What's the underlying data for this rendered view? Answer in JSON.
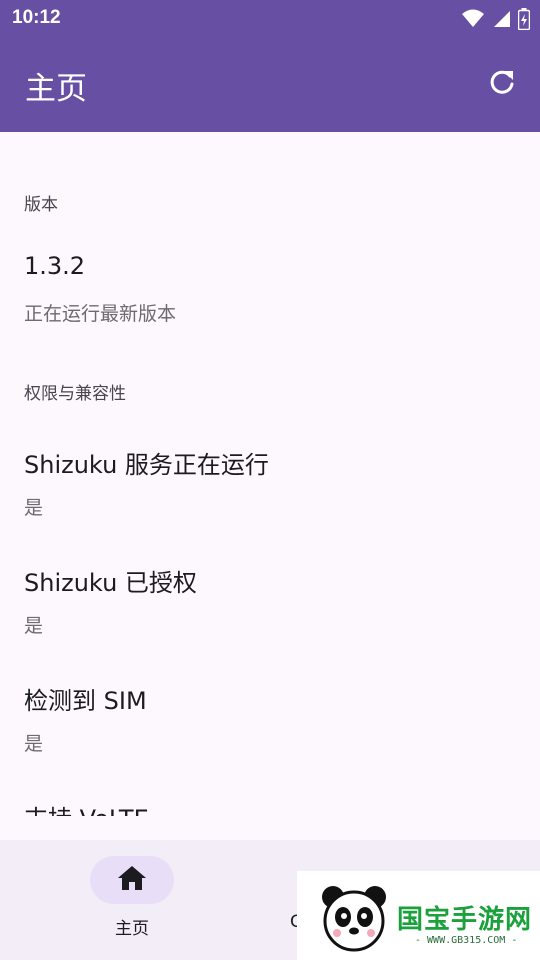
{
  "status": {
    "time": "10:12",
    "icons": [
      "wifi-icon",
      "signal-icon",
      "battery-icon"
    ]
  },
  "app_bar": {
    "title": "主页",
    "action_icon": "refresh-icon"
  },
  "sections": [
    {
      "header": "版本",
      "items": [
        {
          "title": "1.3.2",
          "subtitle": "正在运行最新版本"
        }
      ]
    },
    {
      "header": "权限与兼容性",
      "items": [
        {
          "title": "Shizuku 服务正在运行",
          "subtitle": "是"
        },
        {
          "title": "Shizuku 已授权",
          "subtitle": "是"
        },
        {
          "title": "检测到 SIM",
          "subtitle": "是"
        },
        {
          "title": "支持 VoLTE",
          "subtitle": ""
        }
      ]
    }
  ],
  "bottom_nav": {
    "items": [
      {
        "label": "主页",
        "icon": "home-icon",
        "selected": true
      },
      {
        "label": "C",
        "icon": "",
        "selected": false
      }
    ]
  },
  "watermark": {
    "brand": "国宝手游网",
    "url": "- WWW.GB315.COM -"
  },
  "colors": {
    "primary": "#6750a4",
    "background": "#fdf7fe",
    "nav_background": "#f3edf7",
    "nav_indicator": "#e8def8"
  }
}
